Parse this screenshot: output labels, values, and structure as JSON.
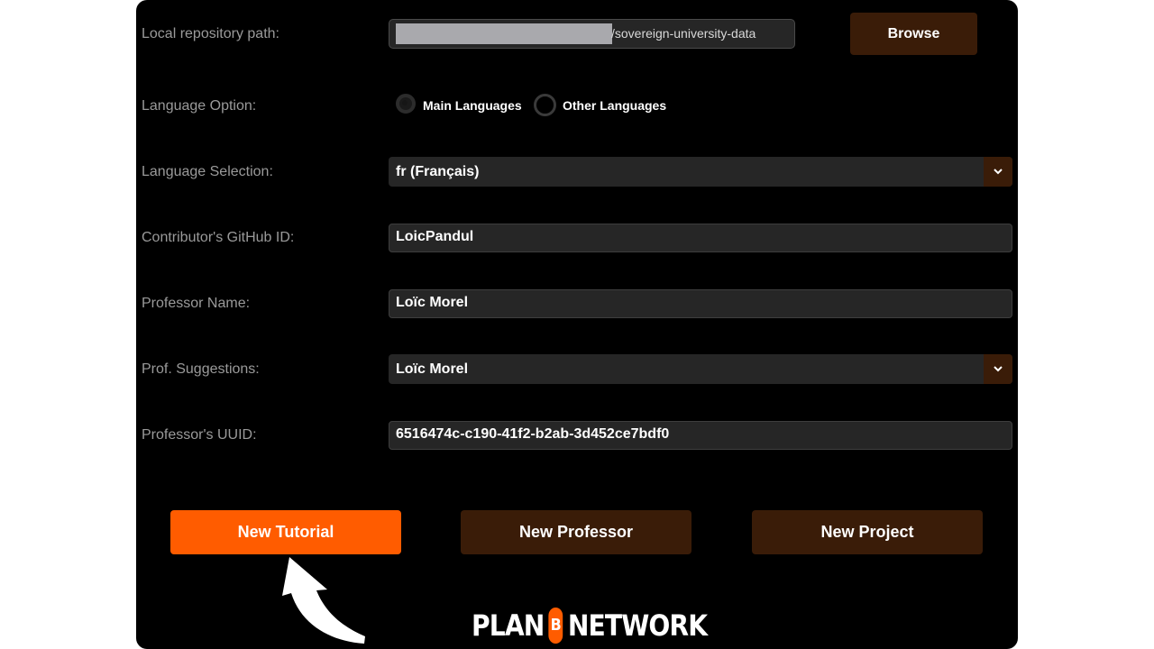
{
  "form": {
    "repo_path": {
      "label": "Local repository path:",
      "value": "/sovereign-university-data",
      "browse_label": "Browse"
    },
    "language_option": {
      "label": "Language Option:",
      "options": [
        "Main Languages",
        "Other Languages"
      ],
      "selected": "Main Languages"
    },
    "language_selection": {
      "label": "Language Selection:",
      "value": "fr (Français)"
    },
    "github_id": {
      "label": "Contributor's GitHub ID:",
      "value": "LoicPandul"
    },
    "professor_name": {
      "label": "Professor Name:",
      "value": "Loïc Morel"
    },
    "prof_suggestions": {
      "label": "Prof. Suggestions:",
      "value": "Loïc Morel"
    },
    "professor_uuid": {
      "label": "Professor's UUID:",
      "value": "6516474c-c190-41f2-b2ab-3d452ce7bdf0"
    }
  },
  "actions": {
    "new_tutorial": "New Tutorial",
    "new_professor": "New Professor",
    "new_project": "New Project"
  },
  "logo": {
    "left": "PLAN",
    "mark": "B",
    "right": "NETWORK"
  },
  "colors": {
    "background": "#000000",
    "accent": "#ff5c00",
    "secondary_button": "#3a1c08",
    "field": "#262626",
    "label": "#9a9a9a"
  },
  "icons": {
    "dropdown": "chevron-down-icon",
    "annotation": "curved-arrow-icon"
  }
}
